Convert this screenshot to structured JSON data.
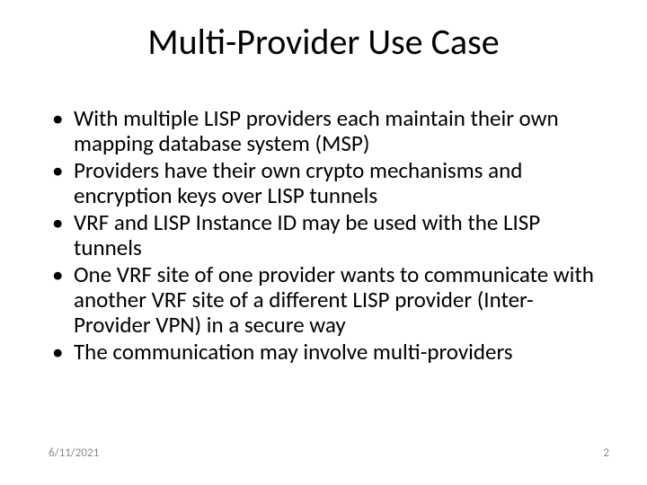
{
  "title": "Multi-Provider Use Case",
  "bullets": [
    "With multiple LISP providers each maintain their own mapping database system (MSP)",
    "Providers have their own crypto mechanisms and encryption keys over LISP tunnels",
    "VRF and LISP Instance ID may be used with the LISP tunnels",
    "One VRF site of one provider wants to communicate with another VRF site of a different LISP provider (Inter-Provider VPN) in a secure way",
    "The communication may involve multi-providers"
  ],
  "footer": {
    "date": "6/11/2021",
    "page": "2"
  }
}
